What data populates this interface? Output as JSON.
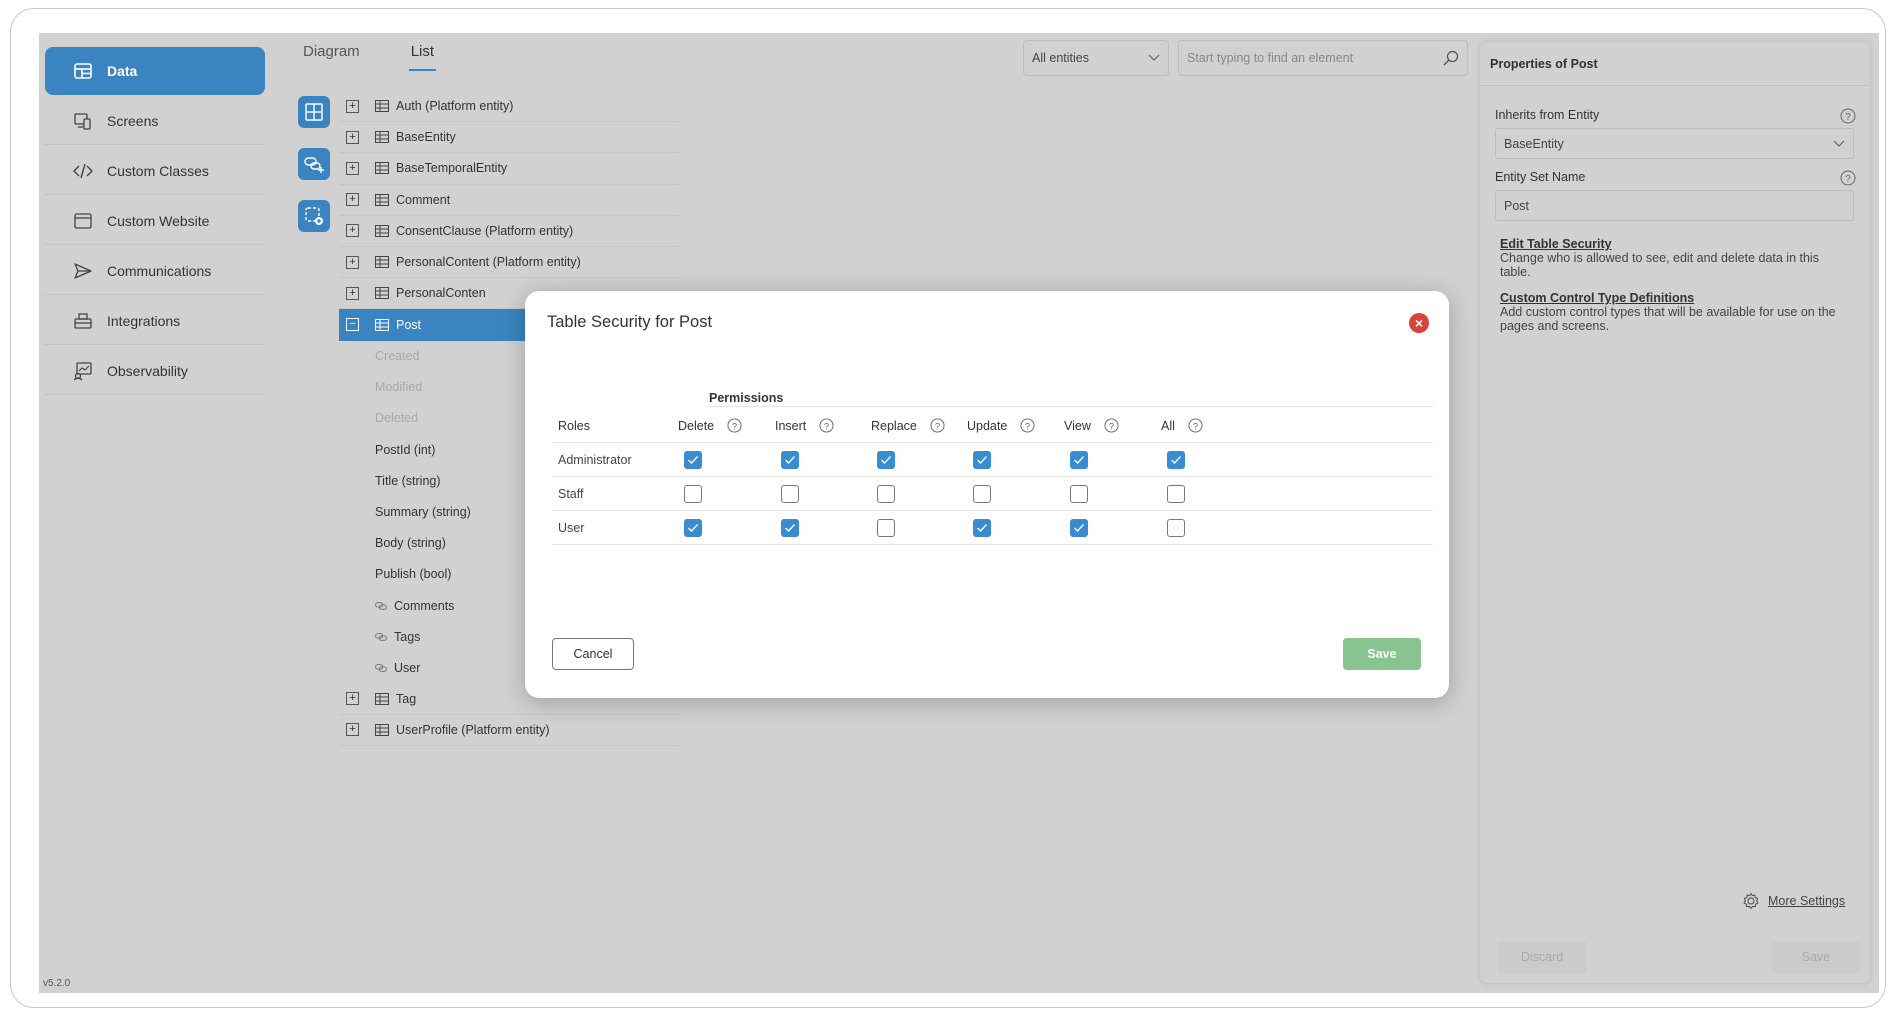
{
  "sidebar": {
    "items": [
      {
        "label": "Data",
        "icon": "table-icon",
        "active": true
      },
      {
        "label": "Screens",
        "icon": "devices-icon",
        "active": false
      },
      {
        "label": "Custom Classes",
        "icon": "code-icon",
        "active": false
      },
      {
        "label": "Custom Website",
        "icon": "browser-window-icon",
        "active": false
      },
      {
        "label": "Communications",
        "icon": "send-icon",
        "active": false
      },
      {
        "label": "Integrations",
        "icon": "integrations-icon",
        "active": false
      },
      {
        "label": "Observability",
        "icon": "monitor-chart-icon",
        "active": false
      }
    ],
    "version": "v5.2.0"
  },
  "tabs": [
    {
      "label": "Diagram",
      "active": false
    },
    {
      "label": "List",
      "active": true
    }
  ],
  "toolbar": {
    "entity_filter": "All entities",
    "search_placeholder": "Start typing to find an element"
  },
  "tree": {
    "entities_top": [
      {
        "label": "Auth (Platform entity)"
      },
      {
        "label": "BaseEntity"
      },
      {
        "label": "BaseTemporalEntity"
      },
      {
        "label": "Comment"
      },
      {
        "label": "ConsentClause (Platform entity)"
      },
      {
        "label": "PersonalContent (Platform entity)"
      },
      {
        "label": "PersonalConten"
      }
    ],
    "selected": {
      "label": "Post"
    },
    "fields": [
      {
        "label": "Created",
        "dim": true,
        "rel": false
      },
      {
        "label": "Modified",
        "dim": true,
        "rel": false
      },
      {
        "label": "Deleted",
        "dim": true,
        "rel": false
      },
      {
        "label": "PostId (int)",
        "dim": false,
        "rel": false
      },
      {
        "label": "Title (string)",
        "dim": false,
        "rel": false
      },
      {
        "label": "Summary (string)",
        "dim": false,
        "rel": false
      },
      {
        "label": "Body (string)",
        "dim": false,
        "rel": false
      },
      {
        "label": "Publish (bool)",
        "dim": false,
        "rel": false
      },
      {
        "label": "Comments",
        "dim": false,
        "rel": true
      },
      {
        "label": "Tags",
        "dim": false,
        "rel": true
      },
      {
        "label": "User",
        "dim": false,
        "rel": true
      }
    ],
    "entities_bottom": [
      {
        "label": "Tag"
      },
      {
        "label": "UserProfile (Platform entity)"
      }
    ]
  },
  "properties": {
    "title": "Properties of Post",
    "inherits_label": "Inherits from Entity",
    "inherits_value": "BaseEntity",
    "set_name_label": "Entity Set Name",
    "set_name_value": "Post",
    "security_link": "Edit Table Security",
    "security_desc": "Change who is allowed to see, edit and delete data in this table.",
    "control_link": "Custom Control Type Definitions",
    "control_desc": "Add custom control types that will be available for use on the pages and screens.",
    "more_settings": "More Settings",
    "discard": "Discard",
    "save": "Save"
  },
  "modal": {
    "title": "Table Security for Post",
    "permissions_heading": "Permissions",
    "roles_header": "Roles",
    "columns": [
      "Delete",
      "Insert",
      "Replace",
      "Update",
      "View",
      "All"
    ],
    "rows": [
      {
        "role": "Administrator",
        "checks": [
          true,
          true,
          true,
          true,
          true,
          true
        ]
      },
      {
        "role": "Staff",
        "checks": [
          false,
          false,
          false,
          false,
          false,
          false
        ]
      },
      {
        "role": "User",
        "checks": [
          true,
          true,
          false,
          true,
          true,
          false
        ]
      }
    ],
    "cancel": "Cancel",
    "save": "Save"
  },
  "colors": {
    "accent": "#3a85c1",
    "checkbox_checked": "#3a8cd0",
    "save_button": "#87c48f",
    "close_button": "#d9433a",
    "overlay_background": "#d1d1d1"
  }
}
